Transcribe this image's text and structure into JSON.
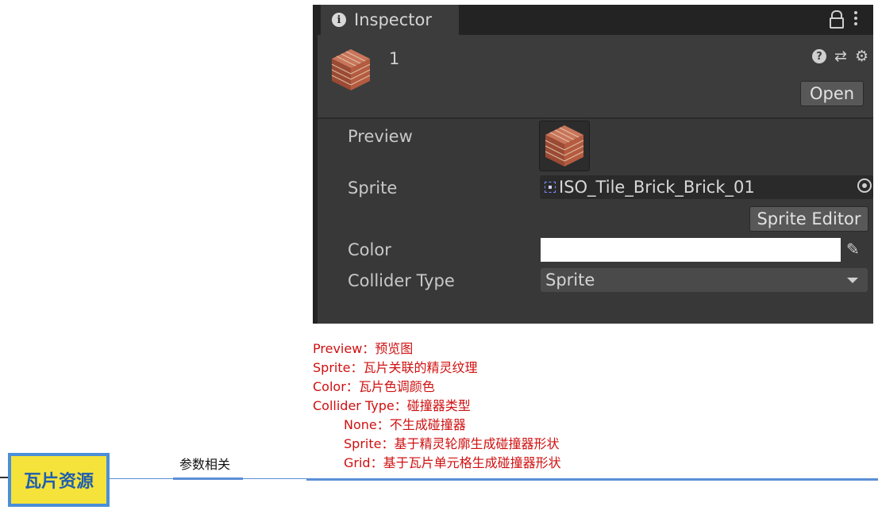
{
  "inspector": {
    "tab_title": "Inspector",
    "object_name": "1",
    "open_label": "Open",
    "properties": {
      "preview_label": "Preview",
      "sprite_label": "Sprite",
      "sprite_value": "ISO_Tile_Brick_Brick_01",
      "sprite_editor_label": "Sprite Editor",
      "color_label": "Color",
      "color_value": "#ffffff",
      "collider_label": "Collider Type",
      "collider_value": "Sprite"
    },
    "icons": [
      "info-icon",
      "lock-icon",
      "kebab-icon",
      "help-icon",
      "preset-icon",
      "gear-icon",
      "object-picker-icon",
      "eyedropper-icon",
      "chevron-down-icon"
    ]
  },
  "notes": [
    "Preview：预览图",
    "Sprite：瓦片关联的精灵纹理",
    "Color：瓦片色调颜色",
    "Collider Type：碰撞器类型"
  ],
  "sub_notes": [
    "None：不生成碰撞器",
    "Sprite：基于精灵轮廓生成碰撞器形状",
    "Grid：基于瓦片单元格生成碰撞器形状"
  ],
  "mindmap": {
    "node_label": "瓦片资源",
    "branch_label": "参数相关",
    "node_color": "#f5e23a",
    "line_color": "#5b8fd6"
  }
}
